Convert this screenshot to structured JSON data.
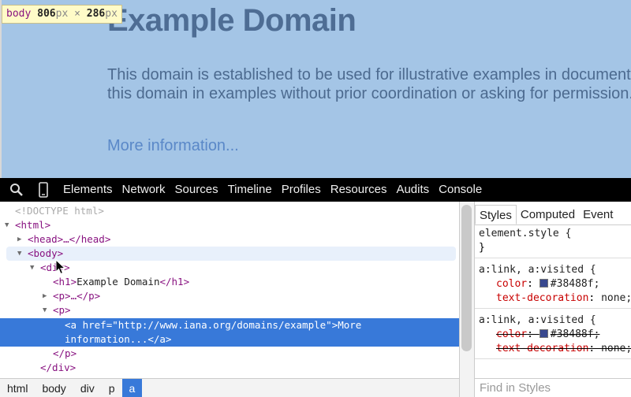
{
  "page": {
    "heading": "Example Domain",
    "paragraph": "This domain is established to be used for illustrative examples in documents. You may use this domain in examples without prior coordination or asking for permission.",
    "link": "More information..."
  },
  "size_tooltip": {
    "tag": "body",
    "width": "806",
    "height": "286",
    "unit": "px",
    "times": "×"
  },
  "toolbar": {
    "tabs": [
      "Elements",
      "Network",
      "Sources",
      "Timeline",
      "Profiles",
      "Resources",
      "Audits",
      "Console"
    ],
    "icons": [
      "search-icon",
      "device-mode-icon"
    ]
  },
  "dom_tree": {
    "doctype": "<!DOCTYPE html>",
    "html_open": "<html>",
    "head": "<head>…</head>",
    "body_open": "<body>",
    "div_open": "<div>",
    "h1_open": "<h1>",
    "h1_text": "Example Domain",
    "h1_close": "</h1>",
    "p_collapsed": "<p>…</p>",
    "p_open": "<p>",
    "a_tag": "<a",
    "a_attr": "href",
    "a_eq": "=",
    "a_value": "\"http://www.iana.org/domains/example\"",
    "a_gt": ">",
    "a_text_1": "More",
    "a_text_2": "information...",
    "a_close": "</a>",
    "p_close": "</p>",
    "div_close": "</div>"
  },
  "breadcrumbs": [
    "html",
    "body",
    "div",
    "p",
    "a"
  ],
  "styles_pane": {
    "tabs": [
      "Styles",
      "Computed",
      "Event"
    ],
    "element_style": "element.style {",
    "close_brace": "}",
    "rule_selector": "a:link, a:visited {",
    "color_prop": "color",
    "color_value": "#38488f;",
    "color_hex": "#38488f",
    "text_decoration_prop": "text-decoration",
    "text_decoration_value": "none;",
    "find_placeholder": "Find in Styles"
  },
  "colors": {
    "highlight_overlay": "#a4c5e6",
    "selection": "#3879d9",
    "tag": "#881280",
    "attr": "#994500",
    "value": "#1a1aa6"
  }
}
